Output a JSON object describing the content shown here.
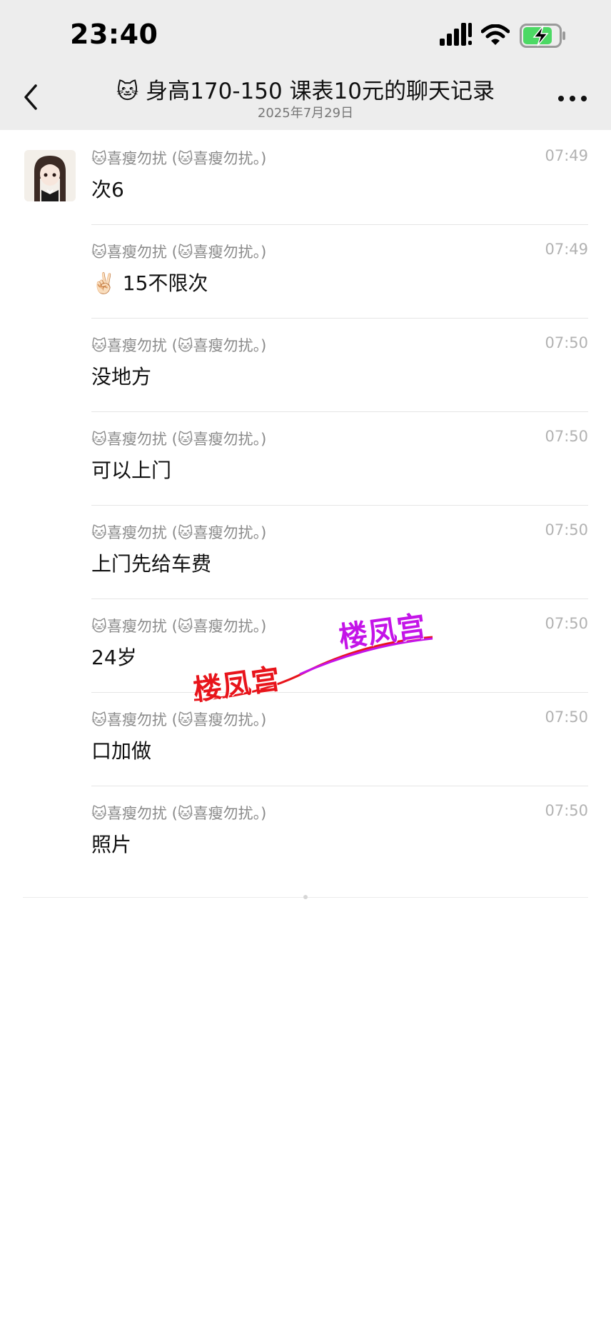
{
  "status_bar": {
    "time": "23:40"
  },
  "nav": {
    "title_emoji": "🐱",
    "title": "身高170-150  课表10元的聊天记录",
    "subtitle": "2025年7月29日"
  },
  "messages": [
    {
      "sender": "🐱喜瘦勿扰 (🐱喜瘦勿扰。)",
      "time": "07:49",
      "text": "次6"
    },
    {
      "sender": "🐱喜瘦勿扰 (🐱喜瘦勿扰。)",
      "time": "07:49",
      "text": "✌🏻 15不限次"
    },
    {
      "sender": "🐱喜瘦勿扰 (🐱喜瘦勿扰。)",
      "time": "07:50",
      "text": "没地方"
    },
    {
      "sender": "🐱喜瘦勿扰 (🐱喜瘦勿扰。)",
      "time": "07:50",
      "text": "可以上门"
    },
    {
      "sender": "🐱喜瘦勿扰 (🐱喜瘦勿扰。)",
      "time": "07:50",
      "text": "上门先给车费"
    },
    {
      "sender": "🐱喜瘦勿扰 (🐱喜瘦勿扰。)",
      "time": "07:50",
      "text": "24岁"
    },
    {
      "sender": "🐱喜瘦勿扰 (🐱喜瘦勿扰。)",
      "time": "07:50",
      "text": "口加做"
    },
    {
      "sender": "🐱喜瘦勿扰 (🐱喜瘦勿扰。)",
      "time": "07:50",
      "text": "照片"
    }
  ],
  "watermark": {
    "text_red": "楼凤宫",
    "text_purple": "楼凤宫",
    "color_red": "#e8141b",
    "color_purple": "#c414e8"
  },
  "icons": {
    "back": "chevron-left-icon",
    "more": "ellipsis-icon",
    "signal": "cellular-signal-icon",
    "wifi": "wifi-icon",
    "battery": "battery-charging-icon"
  },
  "colors": {
    "header_bg": "#ededed",
    "battery_fill": "#4cd964"
  }
}
